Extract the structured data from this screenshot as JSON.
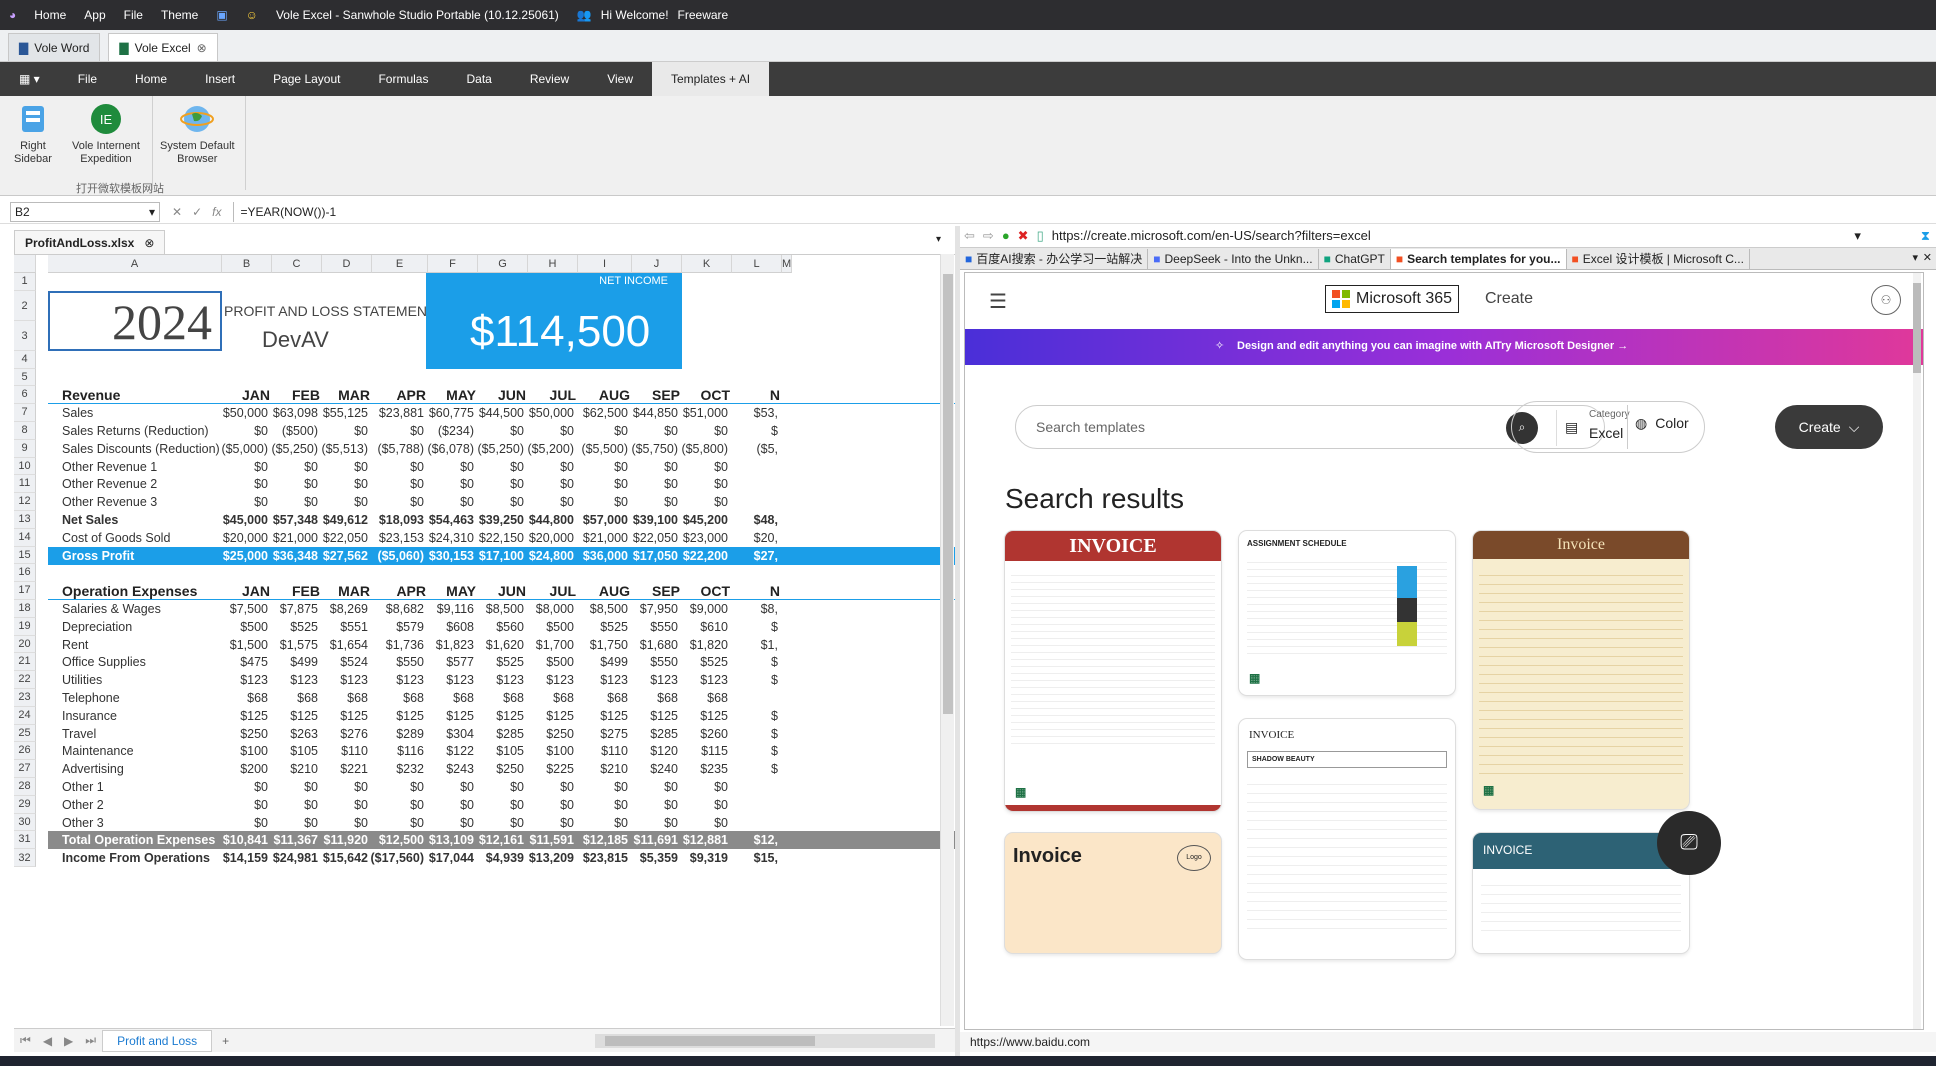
{
  "titlebar": {
    "menu": [
      "Home",
      "App",
      "File",
      "Theme"
    ],
    "title": "Vole Excel - Sanwhole Studio Portable (10.12.25061)",
    "welcome": "Hi Welcome!",
    "license": "Freeware"
  },
  "doc_tabs": [
    "Vole Word",
    "Vole Excel"
  ],
  "ribbon_menu": [
    "File",
    "Home",
    "Insert",
    "Page Layout",
    "Formulas",
    "Data",
    "Review",
    "View",
    "Templates + AI"
  ],
  "ribbon": {
    "buttons": [
      [
        "Right",
        "Sidebar"
      ],
      [
        "Vole Internent",
        "Expedition"
      ],
      [
        "System Default",
        "Browser"
      ]
    ],
    "group": "打开微软模板网站"
  },
  "formula": {
    "cell": "B2",
    "text": "=YEAR(NOW())-1"
  },
  "sheet": {
    "file": "ProfitAndLoss.xlsx",
    "tab": "Profit and Loss",
    "cols": [
      "A",
      "B",
      "C",
      "D",
      "E",
      "F",
      "G",
      "H",
      "I",
      "J",
      "K",
      "L",
      "M"
    ],
    "rows": [
      "1",
      "2",
      "3",
      "4",
      "5",
      "6",
      "7",
      "8",
      "9",
      "10",
      "11",
      "12",
      "13",
      "14",
      "15",
      "16",
      "17",
      "18",
      "19",
      "20",
      "21",
      "22",
      "23",
      "24",
      "25",
      "26",
      "27",
      "28",
      "29",
      "30",
      "31",
      "32"
    ],
    "year": "2024",
    "statement": "PROFIT AND LOSS STATEMENT",
    "company": "DevAV",
    "net_income_label": "NET INCOME",
    "net_income": "$114,500",
    "months": [
      "JAN",
      "FEB",
      "MAR",
      "APR",
      "MAY",
      "JUN",
      "JUL",
      "AUG",
      "SEP",
      "OCT",
      "N"
    ],
    "revenue_title": "Revenue",
    "revenue": [
      {
        "label": "Sales",
        "v": [
          "$50,000",
          "$63,098",
          "$55,125",
          "$23,881",
          "$60,775",
          "$44,500",
          "$50,000",
          "$62,500",
          "$44,850",
          "$51,000",
          "$53,"
        ]
      },
      {
        "label": "Sales Returns (Reduction)",
        "v": [
          "$0",
          "($500)",
          "$0",
          "$0",
          "($234)",
          "$0",
          "$0",
          "$0",
          "$0",
          "$0",
          "$"
        ]
      },
      {
        "label": "Sales Discounts (Reduction)",
        "v": [
          "($5,000)",
          "($5,250)",
          "($5,513)",
          "($5,788)",
          "($6,078)",
          "($5,250)",
          "($5,200)",
          "($5,500)",
          "($5,750)",
          "($5,800)",
          "($5,"
        ]
      },
      {
        "label": "Other Revenue 1",
        "v": [
          "$0",
          "$0",
          "$0",
          "$0",
          "$0",
          "$0",
          "$0",
          "$0",
          "$0",
          "$0",
          ""
        ]
      },
      {
        "label": "Other Revenue 2",
        "v": [
          "$0",
          "$0",
          "$0",
          "$0",
          "$0",
          "$0",
          "$0",
          "$0",
          "$0",
          "$0",
          ""
        ]
      },
      {
        "label": "Other Revenue 3",
        "v": [
          "$0",
          "$0",
          "$0",
          "$0",
          "$0",
          "$0",
          "$0",
          "$0",
          "$0",
          "$0",
          ""
        ]
      },
      {
        "label": "Net Sales",
        "v": [
          "$45,000",
          "$57,348",
          "$49,612",
          "$18,093",
          "$54,463",
          "$39,250",
          "$44,800",
          "$57,000",
          "$39,100",
          "$45,200",
          "$48,"
        ],
        "bold": true
      },
      {
        "label": "Cost of Goods Sold",
        "v": [
          "$20,000",
          "$21,000",
          "$22,050",
          "$23,153",
          "$24,310",
          "$22,150",
          "$20,000",
          "$21,000",
          "$22,050",
          "$23,000",
          "$20,"
        ]
      }
    ],
    "gross": {
      "label": "Gross Profit",
      "v": [
        "$25,000",
        "$36,348",
        "$27,562",
        "($5,060)",
        "$30,153",
        "$17,100",
        "$24,800",
        "$36,000",
        "$17,050",
        "$22,200",
        "$27,"
      ]
    },
    "opex_title": "Operation Expenses",
    "opex": [
      {
        "label": "Salaries & Wages",
        "v": [
          "$7,500",
          "$7,875",
          "$8,269",
          "$8,682",
          "$9,116",
          "$8,500",
          "$8,000",
          "$8,500",
          "$7,950",
          "$9,000",
          "$8,"
        ]
      },
      {
        "label": "Depreciation",
        "v": [
          "$500",
          "$525",
          "$551",
          "$579",
          "$608",
          "$560",
          "$500",
          "$525",
          "$550",
          "$610",
          "$"
        ]
      },
      {
        "label": "Rent",
        "v": [
          "$1,500",
          "$1,575",
          "$1,654",
          "$1,736",
          "$1,823",
          "$1,620",
          "$1,700",
          "$1,750",
          "$1,680",
          "$1,820",
          "$1,"
        ]
      },
      {
        "label": "Office Supplies",
        "v": [
          "$475",
          "$499",
          "$524",
          "$550",
          "$577",
          "$525",
          "$500",
          "$499",
          "$550",
          "$525",
          "$"
        ]
      },
      {
        "label": "Utilities",
        "v": [
          "$123",
          "$123",
          "$123",
          "$123",
          "$123",
          "$123",
          "$123",
          "$123",
          "$123",
          "$123",
          "$"
        ]
      },
      {
        "label": "Telephone",
        "v": [
          "$68",
          "$68",
          "$68",
          "$68",
          "$68",
          "$68",
          "$68",
          "$68",
          "$68",
          "$68",
          ""
        ]
      },
      {
        "label": "Insurance",
        "v": [
          "$125",
          "$125",
          "$125",
          "$125",
          "$125",
          "$125",
          "$125",
          "$125",
          "$125",
          "$125",
          "$"
        ]
      },
      {
        "label": "Travel",
        "v": [
          "$250",
          "$263",
          "$276",
          "$289",
          "$304",
          "$285",
          "$250",
          "$275",
          "$285",
          "$260",
          "$"
        ]
      },
      {
        "label": "Maintenance",
        "v": [
          "$100",
          "$105",
          "$110",
          "$116",
          "$122",
          "$105",
          "$100",
          "$110",
          "$120",
          "$115",
          "$"
        ]
      },
      {
        "label": "Advertising",
        "v": [
          "$200",
          "$210",
          "$221",
          "$232",
          "$243",
          "$250",
          "$225",
          "$210",
          "$240",
          "$235",
          "$"
        ]
      },
      {
        "label": "Other 1",
        "v": [
          "$0",
          "$0",
          "$0",
          "$0",
          "$0",
          "$0",
          "$0",
          "$0",
          "$0",
          "$0",
          ""
        ]
      },
      {
        "label": "Other 2",
        "v": [
          "$0",
          "$0",
          "$0",
          "$0",
          "$0",
          "$0",
          "$0",
          "$0",
          "$0",
          "$0",
          ""
        ]
      },
      {
        "label": "Other 3",
        "v": [
          "$0",
          "$0",
          "$0",
          "$0",
          "$0",
          "$0",
          "$0",
          "$0",
          "$0",
          "$0",
          ""
        ]
      }
    ],
    "total_opex": {
      "label": "Total Operation Expenses",
      "v": [
        "$10,841",
        "$11,367",
        "$11,920",
        "$12,500",
        "$13,109",
        "$12,161",
        "$11,591",
        "$12,185",
        "$11,691",
        "$12,881",
        "$12,"
      ]
    },
    "income_ops": {
      "label": "Income From Operations",
      "v": [
        "$14,159",
        "$24,981",
        "$15,642",
        "($17,560)",
        "$17,044",
        "$4,939",
        "$13,209",
        "$23,815",
        "$5,359",
        "$9,319",
        "$15,"
      ]
    }
  },
  "browser": {
    "url": "https://create.microsoft.com/en-US/search?filters=excel",
    "tabs": [
      "百度AI搜索 - 办公学习一站解决",
      "DeepSeek - Into the Unkn...",
      "ChatGPT",
      "Search templates for you...",
      "Excel 设计模板 | Microsoft C..."
    ],
    "status": "https://www.baidu.com"
  },
  "web": {
    "brand": "Microsoft 365",
    "create": "Create",
    "banner": "Design and edit anything you can imagine with AI",
    "banner_link": "Try Microsoft Designer →",
    "search_placeholder": "Search templates",
    "category_label": "Category",
    "category_value": "Excel",
    "color_label": "Color",
    "create_btn": "Create",
    "results_title": "Search results",
    "cards": [
      "INVOICE",
      "ASSIGNMENT SCHEDULE",
      "Invoice",
      "INVOICE",
      "SHADOW BEAUTY",
      "Invoice",
      "INVOICE"
    ]
  },
  "colors": {
    "accent": "#1b9ee8",
    "titlebar": "#2d2d30",
    "gray_band": "#8a8a8a"
  }
}
